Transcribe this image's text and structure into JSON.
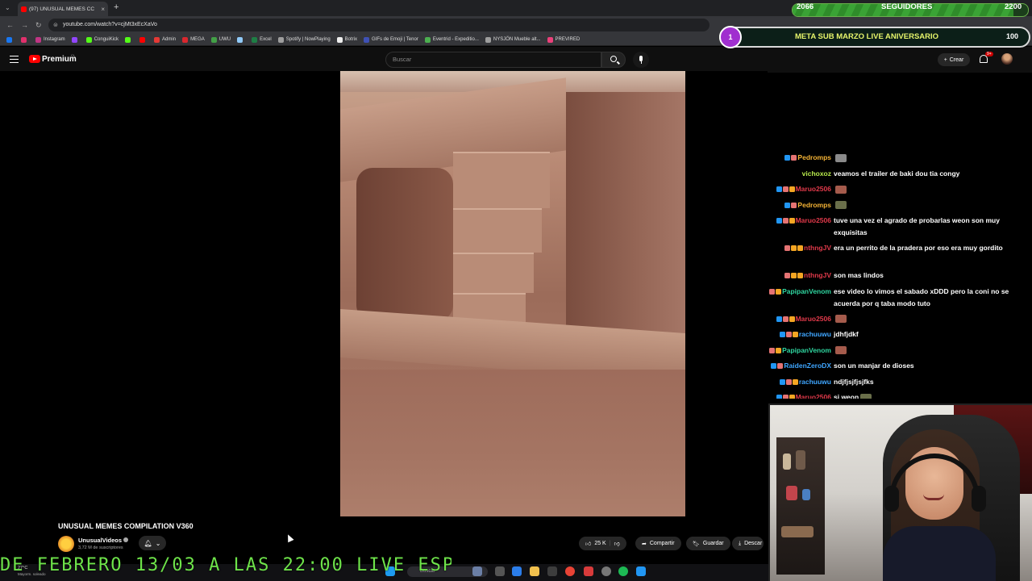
{
  "browser": {
    "tab_title": "(97) UNUSUAL MEMES CC",
    "url": "youtube.com/watch?v=cjMt3xEcXaVo",
    "bookmarks": [
      {
        "label": "",
        "color": "#1877f2"
      },
      {
        "label": "",
        "color": "#e1306c"
      },
      {
        "label": "Instagram",
        "color": "#c13584"
      },
      {
        "label": "",
        "color": "#9146ff"
      },
      {
        "label": "ConguiKick",
        "color": "#53fc18"
      },
      {
        "label": "",
        "color": "#53fc18"
      },
      {
        "label": "",
        "color": "#ff0000"
      },
      {
        "label": "Admin",
        "color": "#e53935"
      },
      {
        "label": "MEGA",
        "color": "#d9272e"
      },
      {
        "label": "UWU",
        "color": "#43a047"
      },
      {
        "label": "",
        "color": "#90caf9"
      },
      {
        "label": "Excel",
        "color": "#1e7e45"
      },
      {
        "label": "Spotify | NowPlaying",
        "color": "#9e9e9e"
      },
      {
        "label": "Botrix",
        "color": "#eeeeee"
      },
      {
        "label": "GIFs de Emoji | Tenor",
        "color": "#3f51b5"
      },
      {
        "label": "Eventrid - Expeditio...",
        "color": "#4caf50"
      },
      {
        "label": "NYSJÖN Mueble alt...",
        "color": "#9e9e9e"
      },
      {
        "label": "PREVIRED",
        "color": "#ec407a"
      }
    ]
  },
  "youtube": {
    "brand": "Premium",
    "region": "CL",
    "search_placeholder": "Buscar",
    "create_label": "Crear",
    "notif_badge": "9+"
  },
  "video": {
    "title": "UNUSUAL MEMES COMPILATION V360",
    "channel": "UnusualVideos",
    "subscribers": "3,72 M de suscriptores",
    "likes": "25 K",
    "share_label": "Compartir",
    "save_label": "Guardar",
    "download_label": "Descar"
  },
  "overlay": {
    "followers_current": "2066",
    "followers_label": "SEGUIDORES",
    "followers_goal": "2200",
    "followers_progress": 0.94,
    "sub_count": "1",
    "sub_goal_title": "META SUB MARZO LIVE ANIVERSARIO",
    "sub_goal_target": "100",
    "ticker": "DE FEBRERO 13/03 A LAS 22:00 LIVE ESPECIA"
  },
  "chat": [
    {
      "user": "Pedromps",
      "color": "#f5b335",
      "text": "",
      "emote": "#8a8a8a",
      "badges": [
        "#2196f3",
        "#e57373"
      ]
    },
    {
      "user": "vichoxoz",
      "color": "#b7e94c",
      "text": "veamos el trailer de baki dou tia congy",
      "emote": null,
      "badges": []
    },
    {
      "user": "Maruo2506",
      "color": "#e0394a",
      "text": "",
      "emote": "#a55b4c",
      "badges": [
        "#2196f3",
        "#e57373",
        "#f5a623"
      ]
    },
    {
      "user": "Pedromps",
      "color": "#f5b335",
      "text": "",
      "emote": "#6a6f4a",
      "badges": [
        "#2196f3",
        "#e57373"
      ]
    },
    {
      "user": "Maruo2506",
      "color": "#e0394a",
      "text": "tuve una vez el agrado de probarlas weon son muy exquisitas",
      "emote": null,
      "badges": [
        "#2196f3",
        "#e57373",
        "#f5a623"
      ]
    },
    {
      "user": "nthngJV",
      "color": "#e0394a",
      "text": "era un perrito de la pradera por eso era muy gordito",
      "emote": null,
      "badges": [
        "#e57373",
        "#f5a623",
        "#f5a623"
      ]
    },
    {
      "user": "nthngJV",
      "color": "#e0394a",
      "text": "son mas lindos",
      "emote": null,
      "badges": [
        "#e57373",
        "#f5a623",
        "#f5a623"
      ]
    },
    {
      "user": "PapipanVenom",
      "color": "#2fd6a0",
      "text": "ese video lo vimos el sabado xDDD pero la coni no se acuerda por q taba modo tuto",
      "emote": null,
      "badges": [
        "#e57373",
        "#f5a623"
      ]
    },
    {
      "user": "Maruo2506",
      "color": "#e0394a",
      "text": "",
      "emote": "#a55b4c",
      "badges": [
        "#2196f3",
        "#e57373",
        "#f5a623"
      ]
    },
    {
      "user": "rachuuwu",
      "color": "#3fa6ff",
      "text": "jdhfjdkf",
      "emote": null,
      "badges": [
        "#2196f3",
        "#e57373",
        "#f5a623"
      ]
    },
    {
      "user": "PapipanVenom",
      "color": "#2fd6a0",
      "text": "",
      "emote": "#a55b4c",
      "badges": [
        "#e57373",
        "#f5a623"
      ]
    },
    {
      "user": "RaidenZeroDX",
      "color": "#3fa6ff",
      "text": "son un manjar de dioses",
      "emote": null,
      "badges": [
        "#2196f3",
        "#e57373"
      ]
    },
    {
      "user": "rachuuwu",
      "color": "#3fa6ff",
      "text": "ndjfjsjfjsjfks",
      "emote": null,
      "badges": [
        "#2196f3",
        "#e57373",
        "#f5a623"
      ]
    },
    {
      "user": "Maruo2506",
      "color": "#e0394a",
      "text": "si weon",
      "emote": "#6a6f4a",
      "badges": [
        "#2196f3",
        "#e57373",
        "#f5a623"
      ]
    }
  ],
  "taskbar": {
    "temperature": "27°C",
    "weather_text": "Mayorm. soleado",
    "search_placeholder": "Buscar"
  }
}
